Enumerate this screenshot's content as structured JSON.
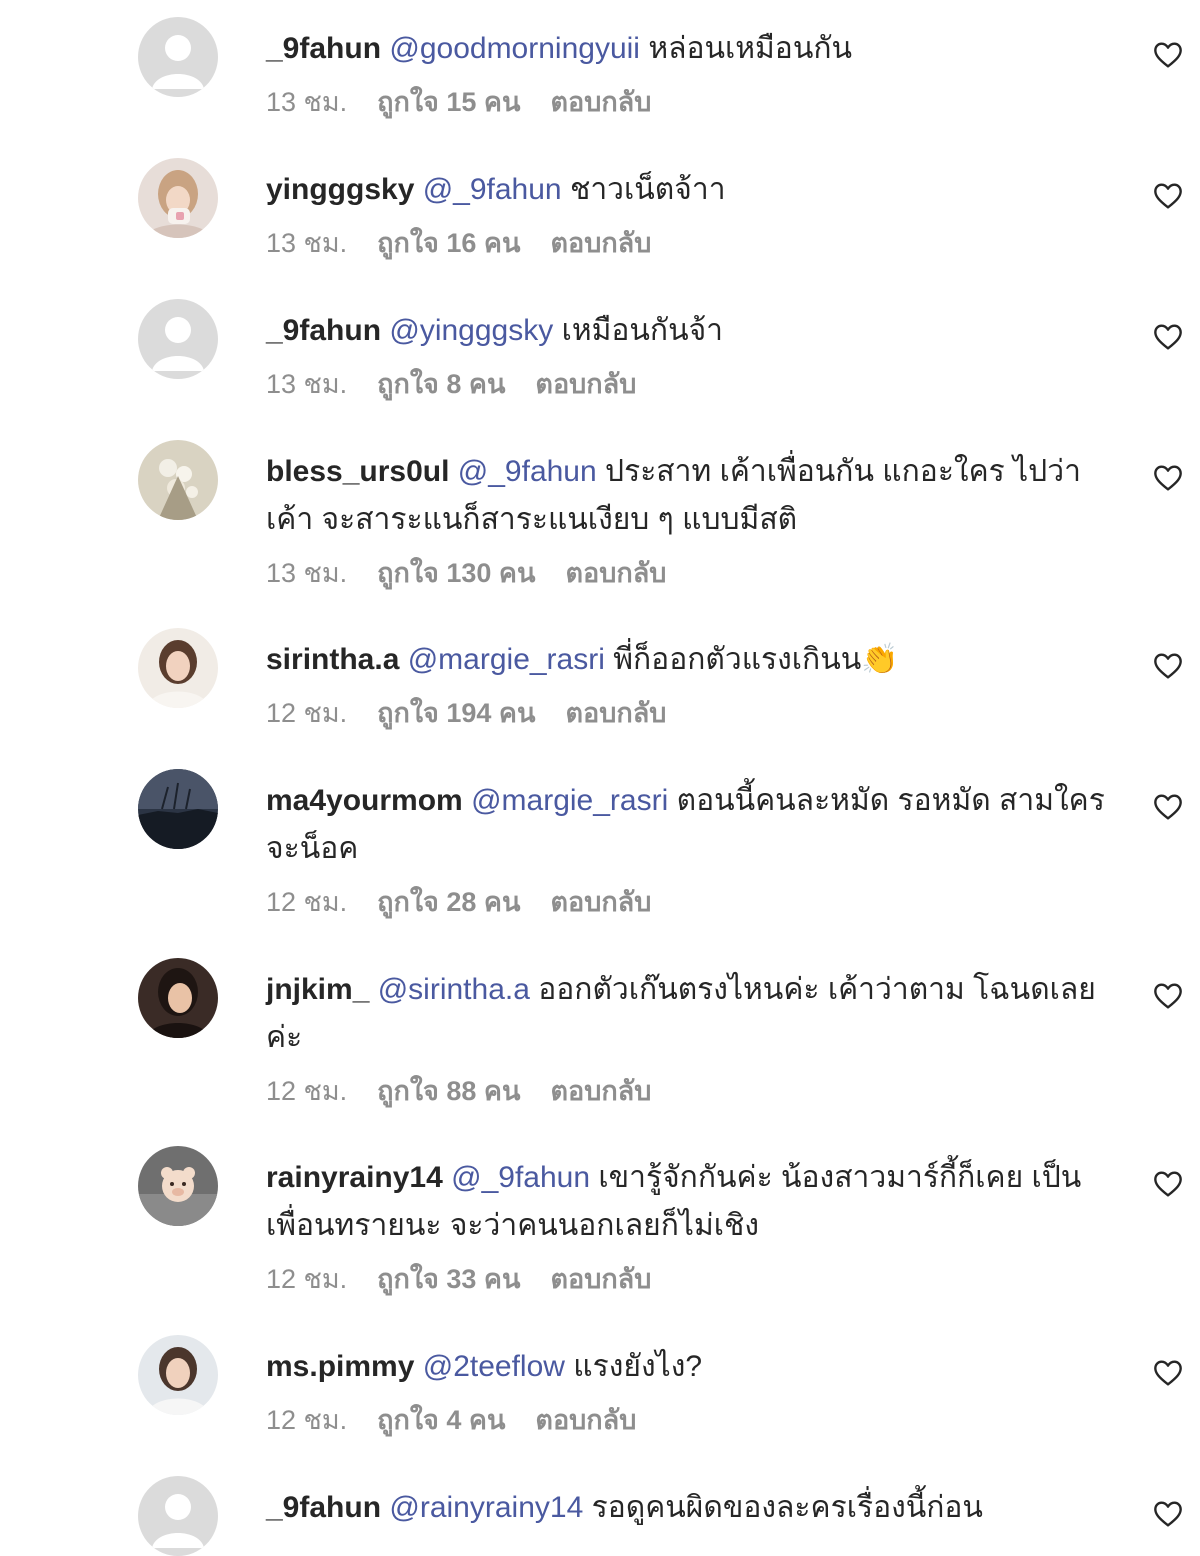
{
  "colors": {
    "username": "#262626",
    "mention": "#4a59a0",
    "meta": "#8e8e8e",
    "heart_outline": "#262626"
  },
  "comments": [
    {
      "username": "_9fahun",
      "mention": "@goodmorningyuii",
      "text": "หล่อนเหมือนกัน",
      "time": "13 ชม.",
      "likes": "ถูกใจ 15 คน",
      "reply": "ตอบกลับ",
      "avatar": "default-avatar-icon"
    },
    {
      "username": "yingggsky",
      "mention": "@_9fahun",
      "text": "ชาวเน็ตจ้าา",
      "time": "13 ชม.",
      "likes": "ถูกใจ 16 คน",
      "reply": "ตอบกลับ",
      "avatar": "profile-photo"
    },
    {
      "username": "_9fahun",
      "mention": "@yingggsky",
      "text": "เหมือนกันจ้า",
      "time": "13 ชม.",
      "likes": "ถูกใจ 8 คน",
      "reply": "ตอบกลับ",
      "avatar": "default-avatar-icon"
    },
    {
      "username": "bless_urs0ul",
      "mention": "@_9fahun",
      "text": "ประสาท เค้าเพื่อนกัน แกอะใคร ไปว่าเค้า จะสาระแนก็สาระแนเงียบ ๆ แบบมีสติ",
      "time": "13 ชม.",
      "likes": "ถูกใจ 130 คน",
      "reply": "ตอบกลับ",
      "avatar": "profile-photo"
    },
    {
      "username": "sirintha.a",
      "mention": "@margie_rasri",
      "text": "พี่ก็ออกตัวแรงเกินน👏",
      "time": "12 ชม.",
      "likes": "ถูกใจ 194 คน",
      "reply": "ตอบกลับ",
      "avatar": "profile-photo"
    },
    {
      "username": "ma4yourmom",
      "mention": "@margie_rasri",
      "text": "ตอนนี้คนละหมัด รอหมัด สามใครจะน็อค",
      "time": "12 ชม.",
      "likes": "ถูกใจ 28 คน",
      "reply": "ตอบกลับ",
      "avatar": "profile-photo"
    },
    {
      "username": "jnjkim_",
      "mention": "@sirintha.a",
      "text": "ออกตัวเก๊นตรงไหนค่ะ เค้าว่าตาม โฉนดเลยค่ะ",
      "time": "12 ชม.",
      "likes": "ถูกใจ 88 คน",
      "reply": "ตอบกลับ",
      "avatar": "profile-photo"
    },
    {
      "username": "rainyrainy14",
      "mention": "@_9fahun",
      "text": "เขารู้จักกันค่ะ น้องสาวมาร์กี้ก็เคย เป็นเพื่อนทรายนะ จะว่าคนนอกเลยก็ไม่เชิง",
      "time": "12 ชม.",
      "likes": "ถูกใจ 33 คน",
      "reply": "ตอบกลับ",
      "avatar": "profile-photo"
    },
    {
      "username": "ms.pimmy",
      "mention": "@2teeflow",
      "text": "แรงยังไง?",
      "time": "12 ชม.",
      "likes": "ถูกใจ 4 คน",
      "reply": "ตอบกลับ",
      "avatar": "profile-photo"
    },
    {
      "username": "_9fahun",
      "mention": "@rainyrainy14",
      "text": "รอดูคนผิดของละครเรื่องนี้ก่อน",
      "time": "",
      "likes": "",
      "reply": "",
      "avatar": "default-avatar-icon"
    }
  ]
}
